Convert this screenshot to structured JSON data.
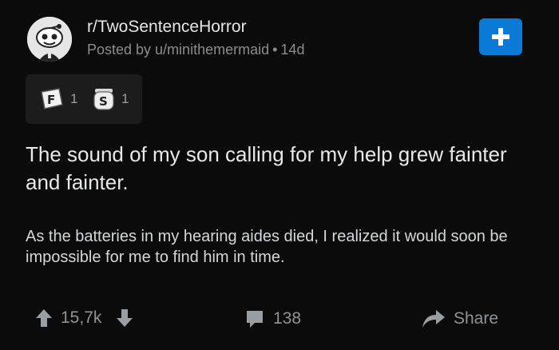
{
  "post": {
    "subreddit": "r/TwoSentenceHorror",
    "posted_by": "Posted by u/minithemermaid",
    "age": "14d",
    "title": "The sound of my son calling for my help grew fainter and fainter.",
    "body": "As the batteries in my hearing aides died, I realized it would soon be impossible for me to find him in time."
  },
  "awards": [
    {
      "icon": "f-key-award-icon",
      "count": "1"
    },
    {
      "icon": "s-award-icon",
      "count": "1"
    }
  ],
  "actions": {
    "score": "15,7k",
    "comments": "138",
    "share_label": "Share"
  },
  "colors": {
    "background": "#0b0b0b",
    "join_button": "#0a7ad6",
    "muted": "#8f9396"
  }
}
